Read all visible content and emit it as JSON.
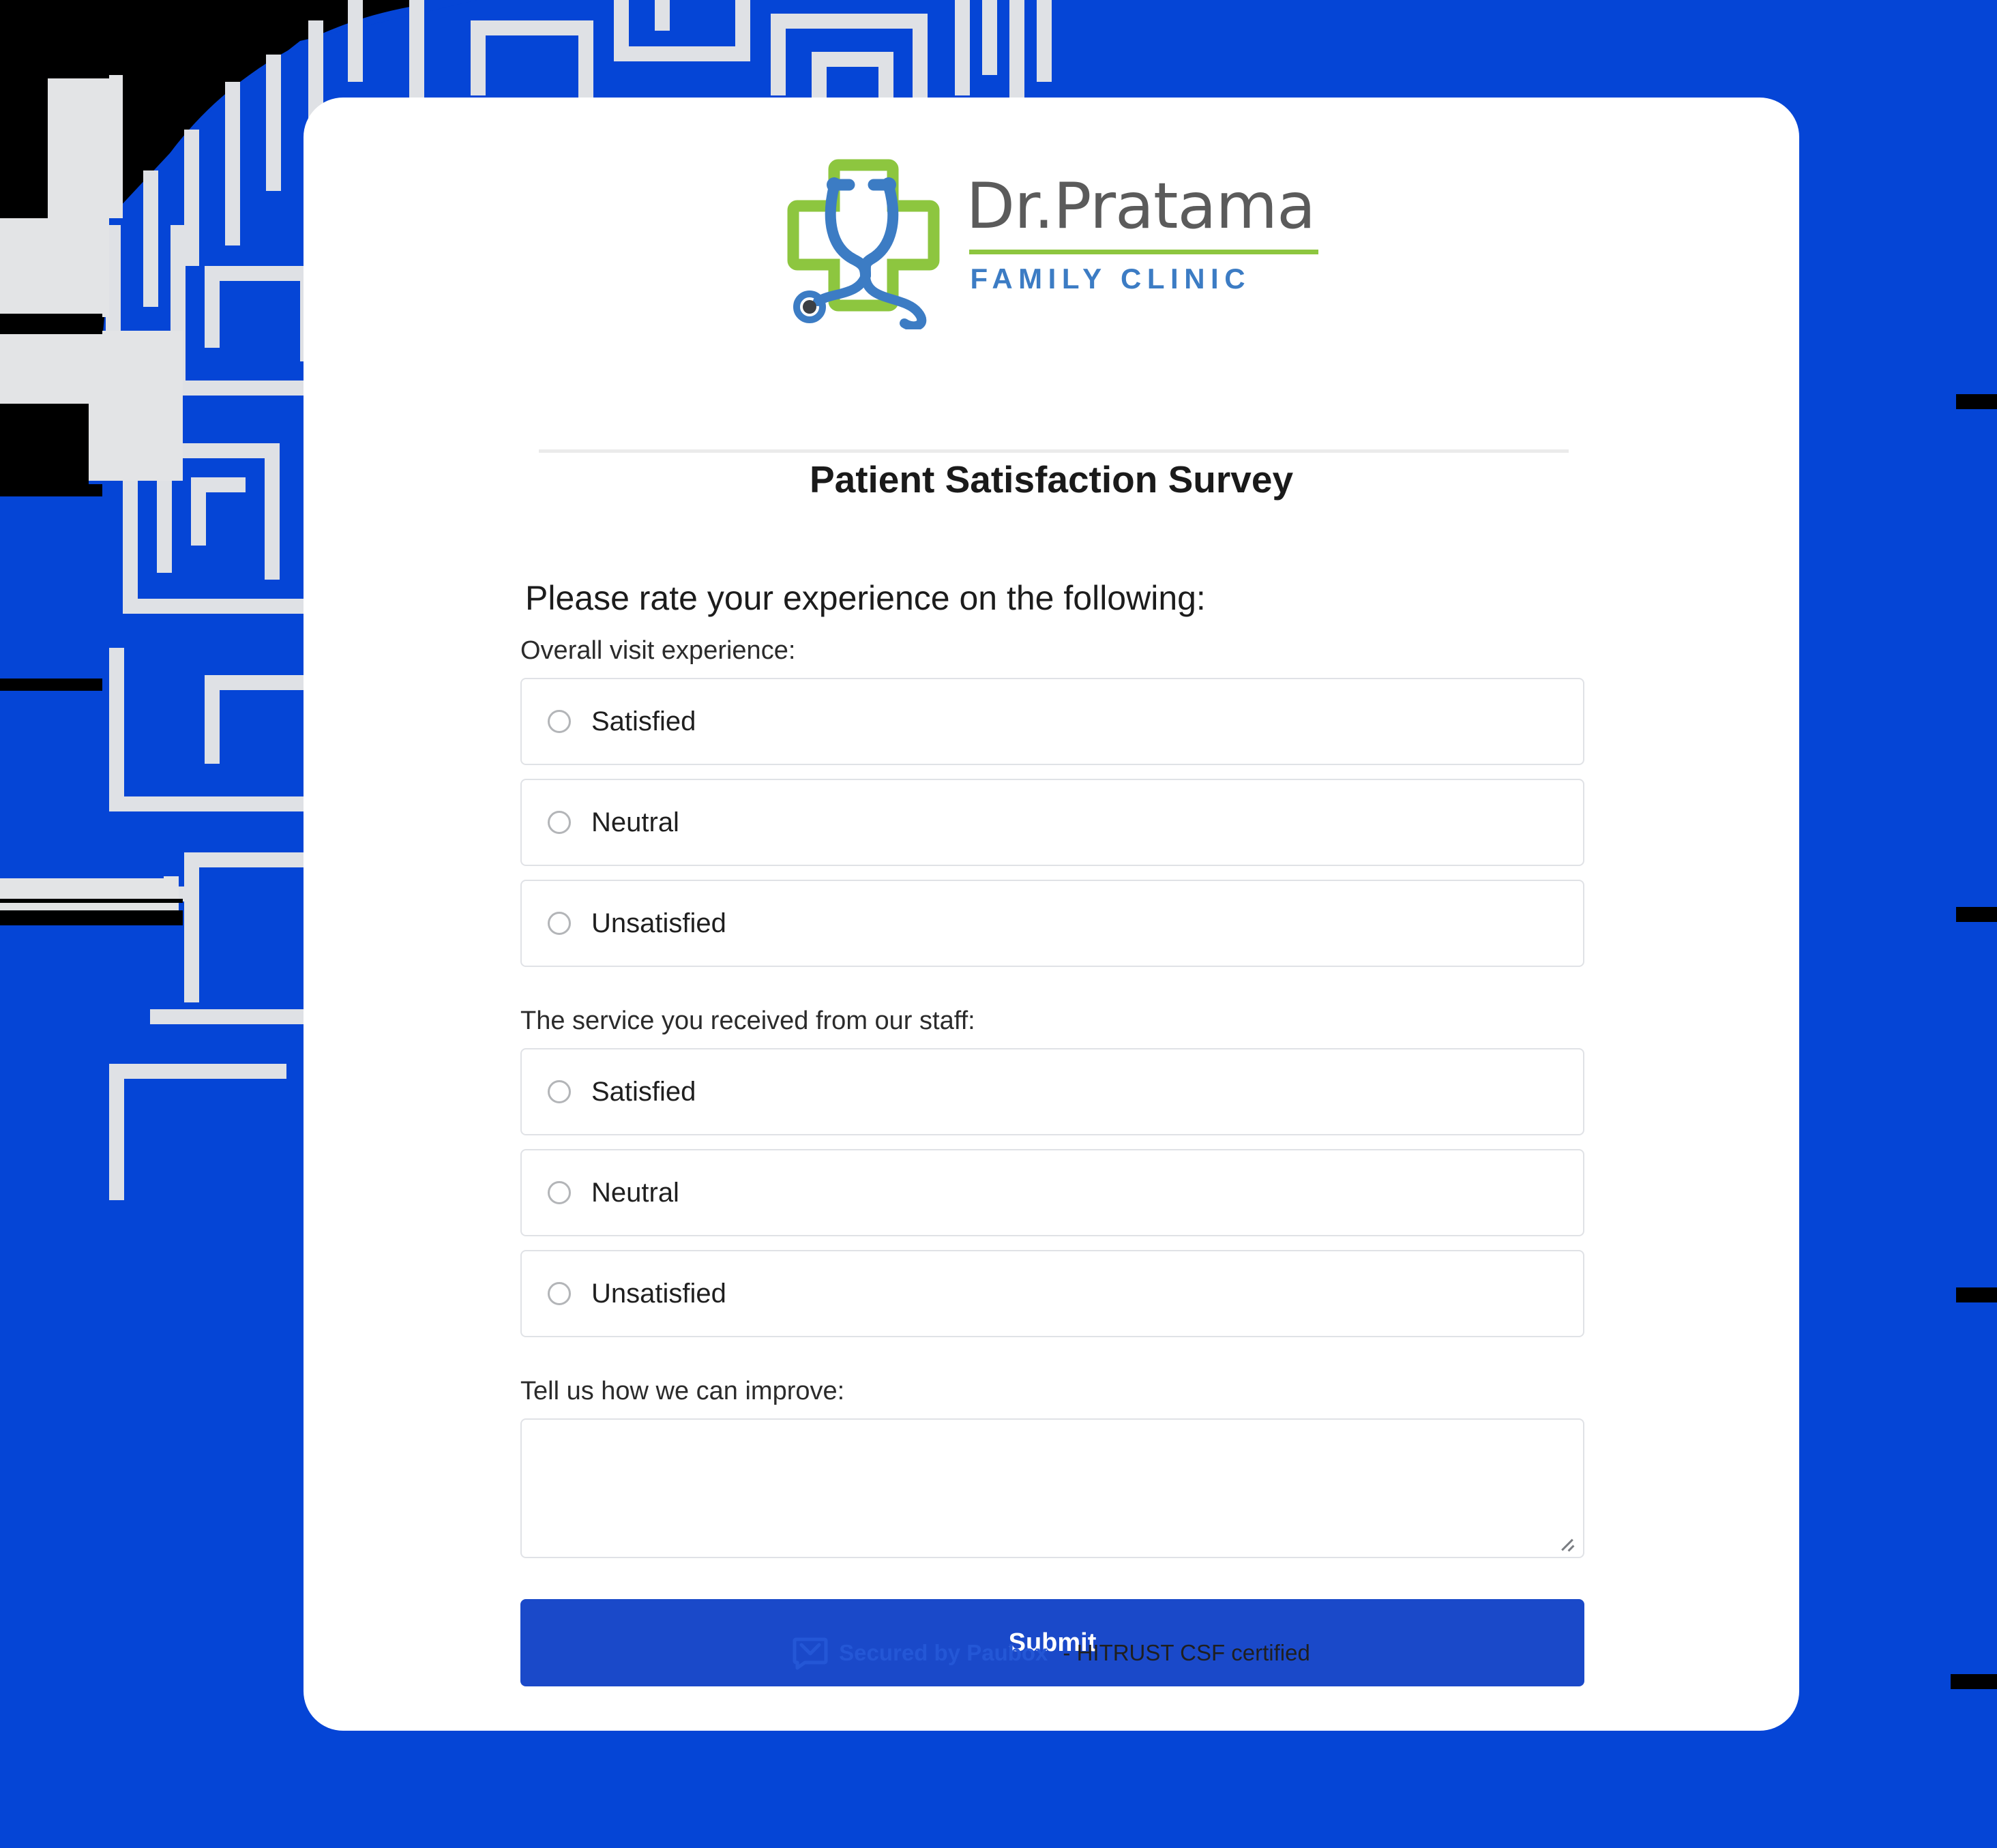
{
  "theme": {
    "background_blue": "#0545D6",
    "card_background": "#FFFFFF",
    "submit_blue": "#1A49C9",
    "logo_green": "#8DC63F",
    "logo_blue": "#3C7CC4",
    "logo_gray": "#5B5B5B",
    "paubox_blue": "#2457D6",
    "border_gray": "#E0E2E6"
  },
  "logo": {
    "icon_name": "medical-cross-stethoscope-logo",
    "name": "Dr.Pratama",
    "subtitle": "FAMILY CLINIC"
  },
  "form": {
    "title": "Patient Satisfaction Survey",
    "section_heading": " Please rate your experience on the following:",
    "questions": [
      {
        "label": "Overall visit experience:",
        "options": [
          {
            "label": "Satisfied",
            "selected": false
          },
          {
            "label": "Neutral",
            "selected": false
          },
          {
            "label": "Unsatisfied",
            "selected": false
          }
        ]
      },
      {
        "label": "The service you received from our staff:",
        "options": [
          {
            "label": "Satisfied",
            "selected": false
          },
          {
            "label": "Neutral",
            "selected": false
          },
          {
            "label": "Unsatisfied",
            "selected": false
          }
        ]
      }
    ],
    "improve": {
      "label": "Tell us how we can improve:",
      "value": "",
      "placeholder": ""
    },
    "submit_label": "Submit"
  },
  "footer": {
    "icon_name": "paubox-envelope-bubble-icon",
    "secured_text": "Secured by Paubox",
    "certification_text": "- HITRUST CSF certified"
  }
}
